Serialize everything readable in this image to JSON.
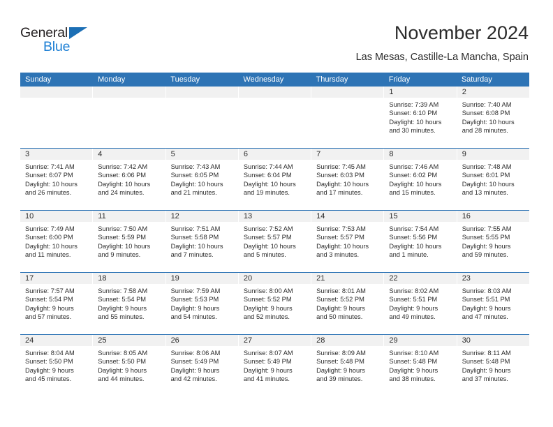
{
  "logo": {
    "word_top": "General",
    "word_bottom": "Blue",
    "triangle_color": "#1c6fb5",
    "blue_text_color": "#1c7fd4"
  },
  "header": {
    "title": "November 2024",
    "subtitle": "Las Mesas, Castille-La Mancha, Spain"
  },
  "theme": {
    "header_blue": "#2e74b5",
    "day_band_gray": "#f1f1f1",
    "text": "#2b2b2b"
  },
  "weekdays": [
    "Sunday",
    "Monday",
    "Tuesday",
    "Wednesday",
    "Thursday",
    "Friday",
    "Saturday"
  ],
  "labels": {
    "sunrise_prefix": "Sunrise:",
    "sunset_prefix": "Sunset:",
    "daylight_prefix": "Daylight:"
  },
  "weeks": [
    [
      {
        "day": "",
        "empty": true
      },
      {
        "day": "",
        "empty": true
      },
      {
        "day": "",
        "empty": true
      },
      {
        "day": "",
        "empty": true
      },
      {
        "day": "",
        "empty": true
      },
      {
        "day": "1",
        "sunrise": "Sunrise: 7:39 AM",
        "sunset": "Sunset: 6:10 PM",
        "daylight_line1": "Daylight: 10 hours",
        "daylight_line2": "and 30 minutes."
      },
      {
        "day": "2",
        "sunrise": "Sunrise: 7:40 AM",
        "sunset": "Sunset: 6:08 PM",
        "daylight_line1": "Daylight: 10 hours",
        "daylight_line2": "and 28 minutes."
      }
    ],
    [
      {
        "day": "3",
        "sunrise": "Sunrise: 7:41 AM",
        "sunset": "Sunset: 6:07 PM",
        "daylight_line1": "Daylight: 10 hours",
        "daylight_line2": "and 26 minutes."
      },
      {
        "day": "4",
        "sunrise": "Sunrise: 7:42 AM",
        "sunset": "Sunset: 6:06 PM",
        "daylight_line1": "Daylight: 10 hours",
        "daylight_line2": "and 24 minutes."
      },
      {
        "day": "5",
        "sunrise": "Sunrise: 7:43 AM",
        "sunset": "Sunset: 6:05 PM",
        "daylight_line1": "Daylight: 10 hours",
        "daylight_line2": "and 21 minutes."
      },
      {
        "day": "6",
        "sunrise": "Sunrise: 7:44 AM",
        "sunset": "Sunset: 6:04 PM",
        "daylight_line1": "Daylight: 10 hours",
        "daylight_line2": "and 19 minutes."
      },
      {
        "day": "7",
        "sunrise": "Sunrise: 7:45 AM",
        "sunset": "Sunset: 6:03 PM",
        "daylight_line1": "Daylight: 10 hours",
        "daylight_line2": "and 17 minutes."
      },
      {
        "day": "8",
        "sunrise": "Sunrise: 7:46 AM",
        "sunset": "Sunset: 6:02 PM",
        "daylight_line1": "Daylight: 10 hours",
        "daylight_line2": "and 15 minutes."
      },
      {
        "day": "9",
        "sunrise": "Sunrise: 7:48 AM",
        "sunset": "Sunset: 6:01 PM",
        "daylight_line1": "Daylight: 10 hours",
        "daylight_line2": "and 13 minutes."
      }
    ],
    [
      {
        "day": "10",
        "sunrise": "Sunrise: 7:49 AM",
        "sunset": "Sunset: 6:00 PM",
        "daylight_line1": "Daylight: 10 hours",
        "daylight_line2": "and 11 minutes."
      },
      {
        "day": "11",
        "sunrise": "Sunrise: 7:50 AM",
        "sunset": "Sunset: 5:59 PM",
        "daylight_line1": "Daylight: 10 hours",
        "daylight_line2": "and 9 minutes."
      },
      {
        "day": "12",
        "sunrise": "Sunrise: 7:51 AM",
        "sunset": "Sunset: 5:58 PM",
        "daylight_line1": "Daylight: 10 hours",
        "daylight_line2": "and 7 minutes."
      },
      {
        "day": "13",
        "sunrise": "Sunrise: 7:52 AM",
        "sunset": "Sunset: 5:57 PM",
        "daylight_line1": "Daylight: 10 hours",
        "daylight_line2": "and 5 minutes."
      },
      {
        "day": "14",
        "sunrise": "Sunrise: 7:53 AM",
        "sunset": "Sunset: 5:57 PM",
        "daylight_line1": "Daylight: 10 hours",
        "daylight_line2": "and 3 minutes."
      },
      {
        "day": "15",
        "sunrise": "Sunrise: 7:54 AM",
        "sunset": "Sunset: 5:56 PM",
        "daylight_line1": "Daylight: 10 hours",
        "daylight_line2": "and 1 minute."
      },
      {
        "day": "16",
        "sunrise": "Sunrise: 7:55 AM",
        "sunset": "Sunset: 5:55 PM",
        "daylight_line1": "Daylight: 9 hours",
        "daylight_line2": "and 59 minutes."
      }
    ],
    [
      {
        "day": "17",
        "sunrise": "Sunrise: 7:57 AM",
        "sunset": "Sunset: 5:54 PM",
        "daylight_line1": "Daylight: 9 hours",
        "daylight_line2": "and 57 minutes."
      },
      {
        "day": "18",
        "sunrise": "Sunrise: 7:58 AM",
        "sunset": "Sunset: 5:54 PM",
        "daylight_line1": "Daylight: 9 hours",
        "daylight_line2": "and 55 minutes."
      },
      {
        "day": "19",
        "sunrise": "Sunrise: 7:59 AM",
        "sunset": "Sunset: 5:53 PM",
        "daylight_line1": "Daylight: 9 hours",
        "daylight_line2": "and 54 minutes."
      },
      {
        "day": "20",
        "sunrise": "Sunrise: 8:00 AM",
        "sunset": "Sunset: 5:52 PM",
        "daylight_line1": "Daylight: 9 hours",
        "daylight_line2": "and 52 minutes."
      },
      {
        "day": "21",
        "sunrise": "Sunrise: 8:01 AM",
        "sunset": "Sunset: 5:52 PM",
        "daylight_line1": "Daylight: 9 hours",
        "daylight_line2": "and 50 minutes."
      },
      {
        "day": "22",
        "sunrise": "Sunrise: 8:02 AM",
        "sunset": "Sunset: 5:51 PM",
        "daylight_line1": "Daylight: 9 hours",
        "daylight_line2": "and 49 minutes."
      },
      {
        "day": "23",
        "sunrise": "Sunrise: 8:03 AM",
        "sunset": "Sunset: 5:51 PM",
        "daylight_line1": "Daylight: 9 hours",
        "daylight_line2": "and 47 minutes."
      }
    ],
    [
      {
        "day": "24",
        "sunrise": "Sunrise: 8:04 AM",
        "sunset": "Sunset: 5:50 PM",
        "daylight_line1": "Daylight: 9 hours",
        "daylight_line2": "and 45 minutes."
      },
      {
        "day": "25",
        "sunrise": "Sunrise: 8:05 AM",
        "sunset": "Sunset: 5:50 PM",
        "daylight_line1": "Daylight: 9 hours",
        "daylight_line2": "and 44 minutes."
      },
      {
        "day": "26",
        "sunrise": "Sunrise: 8:06 AM",
        "sunset": "Sunset: 5:49 PM",
        "daylight_line1": "Daylight: 9 hours",
        "daylight_line2": "and 42 minutes."
      },
      {
        "day": "27",
        "sunrise": "Sunrise: 8:07 AM",
        "sunset": "Sunset: 5:49 PM",
        "daylight_line1": "Daylight: 9 hours",
        "daylight_line2": "and 41 minutes."
      },
      {
        "day": "28",
        "sunrise": "Sunrise: 8:09 AM",
        "sunset": "Sunset: 5:48 PM",
        "daylight_line1": "Daylight: 9 hours",
        "daylight_line2": "and 39 minutes."
      },
      {
        "day": "29",
        "sunrise": "Sunrise: 8:10 AM",
        "sunset": "Sunset: 5:48 PM",
        "daylight_line1": "Daylight: 9 hours",
        "daylight_line2": "and 38 minutes."
      },
      {
        "day": "30",
        "sunrise": "Sunrise: 8:11 AM",
        "sunset": "Sunset: 5:48 PM",
        "daylight_line1": "Daylight: 9 hours",
        "daylight_line2": "and 37 minutes."
      }
    ]
  ]
}
